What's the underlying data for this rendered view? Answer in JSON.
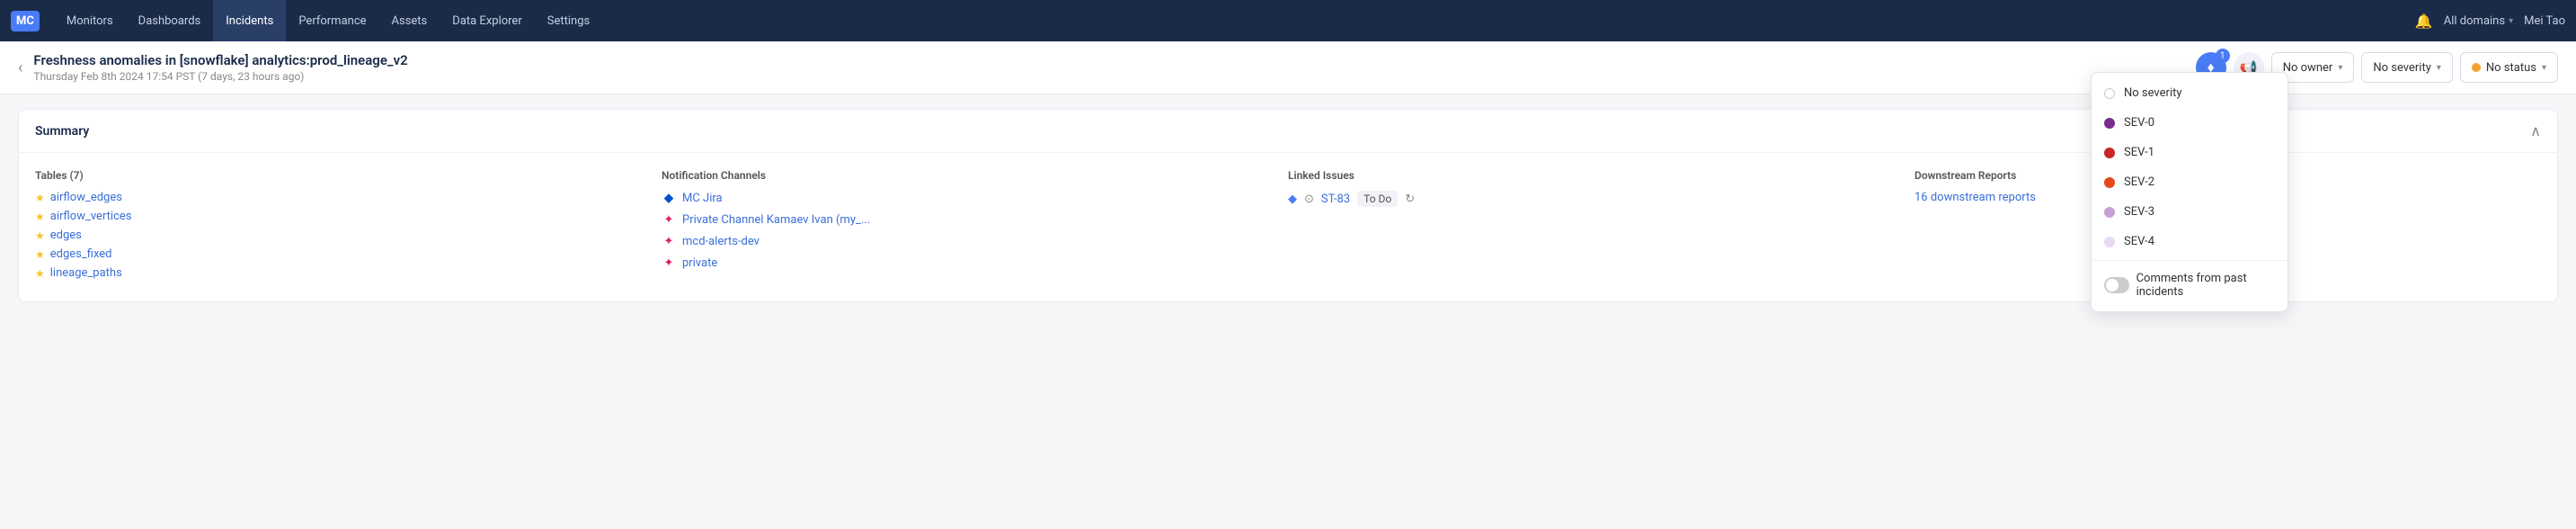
{
  "nav": {
    "logo": "MC",
    "items": [
      {
        "label": "Monitors",
        "active": false
      },
      {
        "label": "Dashboards",
        "active": false
      },
      {
        "label": "Incidents",
        "active": true
      },
      {
        "label": "Performance",
        "active": false
      },
      {
        "label": "Assets",
        "active": false
      },
      {
        "label": "Data Explorer",
        "active": false
      },
      {
        "label": "Settings",
        "active": false
      }
    ],
    "domain_label": "All domains",
    "user_label": "Mei Tao"
  },
  "header": {
    "title": "Freshness anomalies in [snowflake] analytics:prod_lineage_v2",
    "subtitle": "Thursday Feb 8th 2024 17:54 PST (7 days, 23 hours ago)",
    "notification_count": "1",
    "owner_label": "No owner",
    "severity_label": "No severity",
    "status_label": "No status"
  },
  "summary": {
    "title": "Summary",
    "tables_title": "Tables (7)",
    "tables": [
      "airflow_edges",
      "airflow_vertices",
      "edges",
      "edges_fixed",
      "lineage_paths"
    ],
    "channels_title": "Notification Channels",
    "channels": [
      {
        "type": "jira",
        "name": "MC Jira"
      },
      {
        "type": "slack",
        "name": "Private Channel Kamaev Ivan (my_..."
      },
      {
        "type": "slack",
        "name": "mcd-alerts-dev"
      },
      {
        "type": "slack",
        "name": "private"
      }
    ],
    "linked_issues_title": "Linked Issues",
    "issue_key": "ST-83",
    "issue_status": "To Do",
    "downstream_title": "Downstream Reports",
    "downstream_label": "16 downstream reports"
  },
  "severity_dropdown": {
    "items": [
      {
        "label": "No severity",
        "dot": "none"
      },
      {
        "label": "SEV-0",
        "dot": "sev0"
      },
      {
        "label": "SEV-1",
        "dot": "sev1"
      },
      {
        "label": "SEV-2",
        "dot": "sev2"
      },
      {
        "label": "SEV-3",
        "dot": "sev3"
      },
      {
        "label": "SEV-4",
        "dot": "sev4"
      }
    ],
    "toggle_label": "Comments from past incidents"
  }
}
